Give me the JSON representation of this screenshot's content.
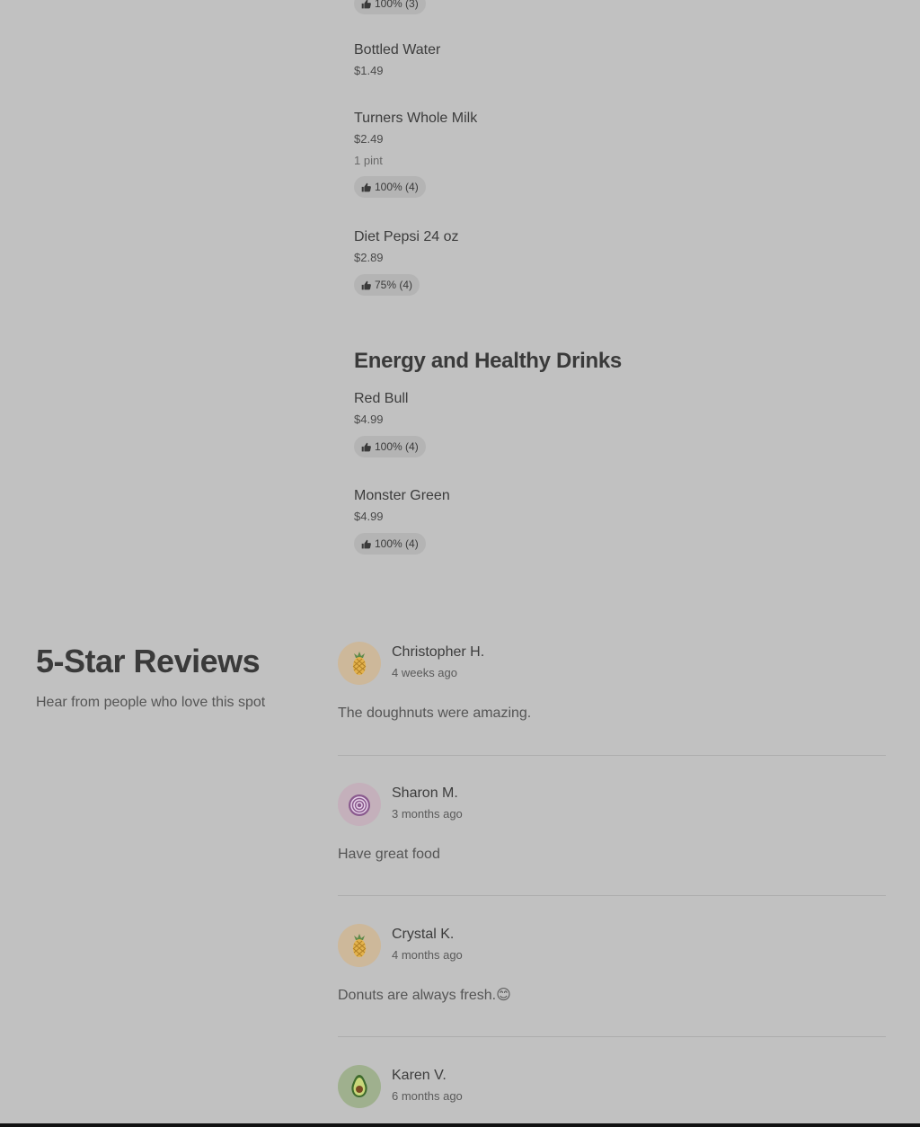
{
  "menu": {
    "top_item": {
      "rating": "100% (3)"
    },
    "drinks": [
      {
        "name": "Bottled Water",
        "price": "$1.49"
      },
      {
        "name": "Turners Whole Milk",
        "price": "$2.49",
        "size": "1 pint",
        "rating": "100% (4)"
      },
      {
        "name": "Diet Pepsi 24 oz",
        "price": "$2.89",
        "rating": "75% (4)"
      }
    ],
    "energy_section": {
      "title": "Energy and Healthy Drinks",
      "items": [
        {
          "name": "Red Bull",
          "price": "$4.99",
          "rating": "100% (4)"
        },
        {
          "name": "Monster Green",
          "price": "$4.99",
          "rating": "100% (4)"
        }
      ]
    }
  },
  "reviews": {
    "heading": "5-Star Reviews",
    "subheading": "Hear from people who love this spot",
    "items": [
      {
        "name": "Christopher H.",
        "date": "4 weeks ago",
        "text": "The doughnuts were amazing.",
        "avatar_icon": "pineapple-icon",
        "avatar_bg": "#cdb89a"
      },
      {
        "name": "Sharon M.",
        "date": "3 months ago",
        "text": "Have great food",
        "avatar_icon": "onion-icon",
        "avatar_bg": "#c4b0bb"
      },
      {
        "name": "Crystal K.",
        "date": "4 months ago",
        "text": "Donuts are always fresh.😊",
        "avatar_icon": "pineapple-icon",
        "avatar_bg": "#cdb89a"
      },
      {
        "name": "Karen V.",
        "date": "6 months ago",
        "avatar_icon": "avocado-icon",
        "avatar_bg": "#9fb08e"
      }
    ]
  },
  "icons": {
    "rating": "thumbs-up-icon"
  }
}
